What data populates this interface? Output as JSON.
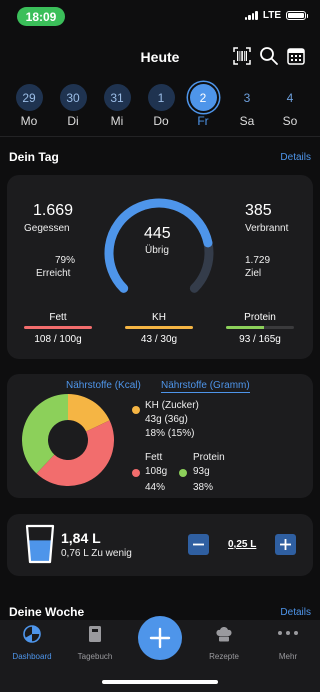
{
  "status": {
    "time": "18:09",
    "network": "LTE"
  },
  "header": {
    "title": "Heute",
    "icons": [
      "barcode-icon",
      "search-icon",
      "calendar-icon"
    ]
  },
  "days": [
    {
      "num": "29",
      "label": "Mo",
      "state": "past"
    },
    {
      "num": "30",
      "label": "Di",
      "state": "past"
    },
    {
      "num": "31",
      "label": "Mi",
      "state": "past"
    },
    {
      "num": "1",
      "label": "Do",
      "state": "past"
    },
    {
      "num": "2",
      "label": "Fr",
      "state": "active"
    },
    {
      "num": "3",
      "label": "Sa",
      "state": "future"
    },
    {
      "num": "4",
      "label": "So",
      "state": "future"
    }
  ],
  "dein_tag": {
    "title": "Dein Tag",
    "details": "Details",
    "eaten_value": "1.669",
    "eaten_label": "Gegessen",
    "reached_pct": "79%",
    "reached_label": "Erreicht",
    "remaining_value": "445",
    "remaining_label": "Übrig",
    "burned_value": "385",
    "burned_label": "Verbrannt",
    "goal_value": "1.729",
    "goal_label": "Ziel",
    "gauge_fraction": 0.79,
    "macros": [
      {
        "label": "Fett",
        "value": "108 / 100g",
        "fraction": 1.0,
        "color": "#f26d6d"
      },
      {
        "label": "KH",
        "value": "43 / 30g",
        "fraction": 1.0,
        "color": "#f5b544"
      },
      {
        "label": "Protein",
        "value": "93 / 165g",
        "fraction": 0.56,
        "color": "#8cd05a"
      }
    ]
  },
  "naehrstoffe": {
    "tab_kcal": "Nährstoffe (Kcal)",
    "tab_gramm": "Nährstoffe (Gramm)",
    "kh_title": "KH (Zucker)",
    "kh_line1": "43g (36g)",
    "kh_line2": "18% (15%)",
    "fett_title": "Fett",
    "fett_line1": "108g",
    "fett_line2": "44%",
    "protein_title": "Protein",
    "protein_line1": "93g",
    "protein_line2": "38%",
    "donut": [
      {
        "name": "KH",
        "pct": 18,
        "color": "#f5b544"
      },
      {
        "name": "Fett",
        "pct": 44,
        "color": "#f26d6d"
      },
      {
        "name": "Protein",
        "pct": 38,
        "color": "#8cd05a"
      }
    ]
  },
  "water": {
    "amount": "1,84 L",
    "note": "0,76 L Zu wenig",
    "step": "0,25 L",
    "fill_fraction": 0.6
  },
  "deine_woche": {
    "title": "Deine Woche",
    "details": "Details"
  },
  "nav": [
    {
      "label": "Dashboard",
      "icon": "dashboard-icon",
      "active": true
    },
    {
      "label": "Tagebuch",
      "icon": "diary-icon",
      "active": false
    },
    {
      "label": "",
      "icon": "add-icon",
      "active": false
    },
    {
      "label": "Rezepte",
      "icon": "chef-hat-icon",
      "active": false
    },
    {
      "label": "Mehr",
      "icon": "more-icon",
      "active": false
    }
  ],
  "colors": {
    "accent": "#4e95ea",
    "card": "#1c1c1e",
    "background": "#0e0e0f"
  }
}
